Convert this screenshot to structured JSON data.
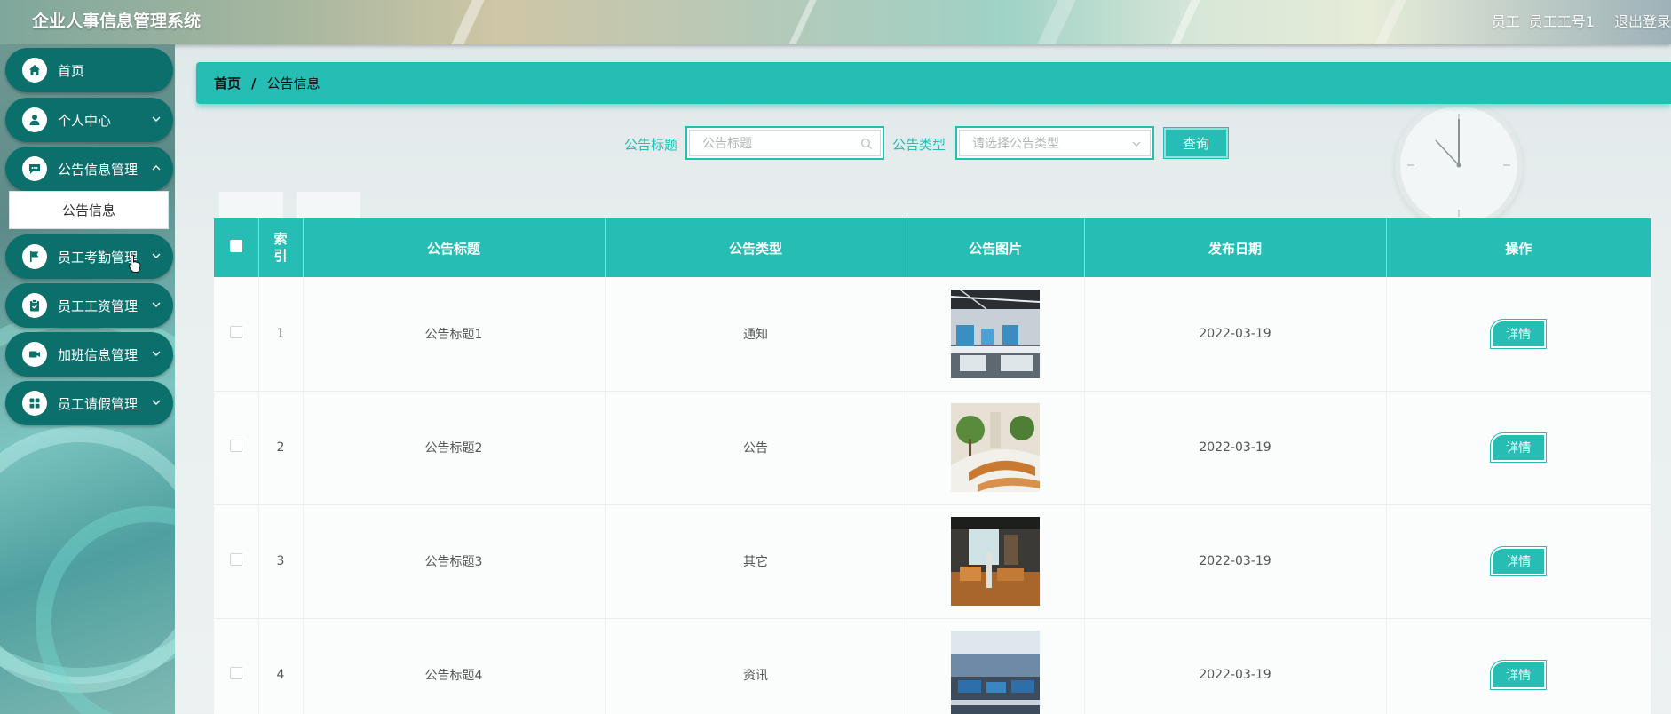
{
  "header": {
    "app_title": "企业人事信息管理系统",
    "user_role": "员工",
    "user_name": "员工工号1",
    "logout": "退出登录"
  },
  "sidebar": {
    "items": [
      {
        "label": "首页",
        "icon": "home-icon"
      },
      {
        "label": "个人中心",
        "icon": "user-icon"
      },
      {
        "label": "公告信息管理",
        "icon": "message-icon"
      },
      {
        "label": "员工考勤管理",
        "icon": "flag-icon"
      },
      {
        "label": "员工工资管理",
        "icon": "clipboard-check-icon"
      },
      {
        "label": "加班信息管理",
        "icon": "video-icon"
      },
      {
        "label": "员工请假管理",
        "icon": "grid-icon"
      }
    ],
    "submenu_label": "公告信息"
  },
  "breadcrumb": {
    "home": "首页",
    "separator": "/",
    "current": "公告信息"
  },
  "search": {
    "title_label": "公告标题",
    "title_placeholder": "公告标题",
    "type_label": "公告类型",
    "type_placeholder": "请选择公告类型",
    "query_button": "查询"
  },
  "table": {
    "headers": {
      "index": "索引",
      "title": "公告标题",
      "type": "公告类型",
      "image": "公告图片",
      "date": "发布日期",
      "action": "操作"
    },
    "rows": [
      {
        "index": "1",
        "title": "公告标题1",
        "type": "通知",
        "date": "2022-03-19",
        "action": "详情"
      },
      {
        "index": "2",
        "title": "公告标题2",
        "type": "公告",
        "date": "2022-03-19",
        "action": "详情"
      },
      {
        "index": "3",
        "title": "公告标题3",
        "type": "其它",
        "date": "2022-03-19",
        "action": "详情"
      },
      {
        "index": "4",
        "title": "公告标题4",
        "type": "资讯",
        "date": "2022-03-19",
        "action": "详情"
      }
    ]
  },
  "colors": {
    "accent": "#25bdb4",
    "sidebar_item": "#0b6f6c"
  }
}
